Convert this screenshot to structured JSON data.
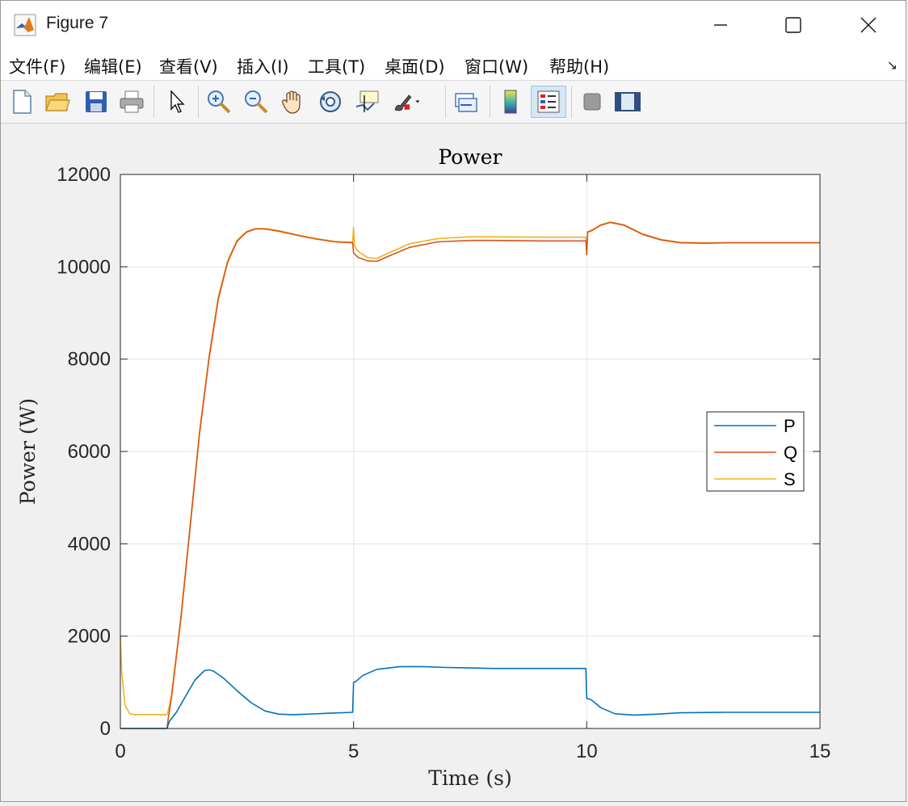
{
  "window": {
    "title": "Figure 7",
    "menu": [
      "文件(F)",
      "编辑(E)",
      "查看(V)",
      "插入(I)",
      "工具(T)",
      "桌面(D)",
      "窗口(W)",
      "帮助(H)"
    ],
    "toolbar_icons": [
      "new-figure-icon",
      "open-icon",
      "save-icon",
      "print-icon",
      "pointer-icon",
      "zoom-in-icon",
      "zoom-out-icon",
      "pan-icon",
      "rotate-3d-icon",
      "data-cursor-icon",
      "brush-icon",
      "link-icon",
      "colorbar-icon",
      "legend-icon",
      "hide-plot-tools-icon",
      "show-plot-tools-icon"
    ]
  },
  "chart_data": {
    "type": "line",
    "title": "Power",
    "xlabel": "Time (s)",
    "ylabel": "Power (W)",
    "xlim": [
      0,
      15
    ],
    "ylim": [
      0,
      12000
    ],
    "xticks": [
      0,
      5,
      10,
      15
    ],
    "yticks": [
      0,
      2000,
      4000,
      6000,
      8000,
      10000,
      12000
    ],
    "grid": true,
    "legend_position": "right",
    "series": [
      {
        "name": "P",
        "color": "#0072BD",
        "x": [
          0,
          1.0,
          1.05,
          1.2,
          1.4,
          1.6,
          1.8,
          1.9,
          2.0,
          2.2,
          2.5,
          2.8,
          3.1,
          3.4,
          3.7,
          4.0,
          4.5,
          4.98,
          5.0,
          5.05,
          5.2,
          5.5,
          6.0,
          6.5,
          7.0,
          7.5,
          8.0,
          9.0,
          9.98,
          10.0,
          10.05,
          10.1,
          10.3,
          10.6,
          11.0,
          11.5,
          12.0,
          13.0,
          14.0,
          15.0
        ],
        "y": [
          0,
          0,
          150,
          350,
          700,
          1050,
          1250,
          1270,
          1240,
          1100,
          820,
          560,
          380,
          310,
          300,
          310,
          330,
          350,
          1000,
          1020,
          1150,
          1280,
          1340,
          1340,
          1320,
          1310,
          1300,
          1300,
          1300,
          650,
          640,
          620,
          450,
          320,
          290,
          310,
          340,
          350,
          350,
          350
        ]
      },
      {
        "name": "Q",
        "color": "#D95319",
        "x": [
          0,
          0.2,
          1.0,
          1.03,
          1.1,
          1.3,
          1.5,
          1.7,
          1.9,
          2.1,
          2.3,
          2.5,
          2.7,
          2.9,
          3.1,
          3.4,
          3.8,
          4.2,
          4.6,
          4.98,
          5.0,
          5.02,
          5.1,
          5.3,
          5.5,
          5.8,
          6.2,
          6.8,
          7.5,
          8.0,
          9.0,
          9.98,
          10.0,
          10.02,
          10.1,
          10.3,
          10.5,
          10.8,
          11.2,
          11.6,
          12.0,
          12.5,
          13.0,
          14.0,
          15.0
        ],
        "y": [
          0,
          0,
          0,
          250,
          700,
          2400,
          4400,
          6400,
          8000,
          9300,
          10100,
          10550,
          10750,
          10820,
          10820,
          10770,
          10680,
          10600,
          10540,
          10520,
          10300,
          10280,
          10200,
          10130,
          10120,
          10250,
          10420,
          10540,
          10570,
          10570,
          10560,
          10560,
          10260,
          10750,
          10780,
          10900,
          10960,
          10900,
          10700,
          10580,
          10520,
          10510,
          10520,
          10520,
          10520
        ]
      },
      {
        "name": "S",
        "color": "#EDB120",
        "x": [
          0,
          0.03,
          0.1,
          0.2,
          0.3,
          0.5,
          1.0,
          1.03,
          1.1,
          1.3,
          1.5,
          1.7,
          1.9,
          2.1,
          2.3,
          2.5,
          2.7,
          2.9,
          3.1,
          3.4,
          3.8,
          4.2,
          4.6,
          4.98,
          5.0,
          5.02,
          5.1,
          5.3,
          5.5,
          5.8,
          6.2,
          6.8,
          7.5,
          8.0,
          9.0,
          9.98,
          10.0,
          10.02,
          10.1,
          10.3,
          10.5,
          10.8,
          11.2,
          11.6,
          12.0,
          12.5,
          13.0,
          14.0,
          15.0
        ],
        "y": [
          2000,
          1200,
          500,
          320,
          300,
          300,
          300,
          400,
          750,
          2450,
          4450,
          6450,
          8050,
          9350,
          10130,
          10570,
          10760,
          10830,
          10830,
          10780,
          10690,
          10610,
          10550,
          10530,
          10850,
          10450,
          10330,
          10200,
          10180,
          10320,
          10500,
          10610,
          10650,
          10650,
          10640,
          10640,
          10350,
          10760,
          10790,
          10910,
          10970,
          10910,
          10710,
          10590,
          10530,
          10520,
          10520,
          10520,
          10520
        ]
      }
    ]
  }
}
